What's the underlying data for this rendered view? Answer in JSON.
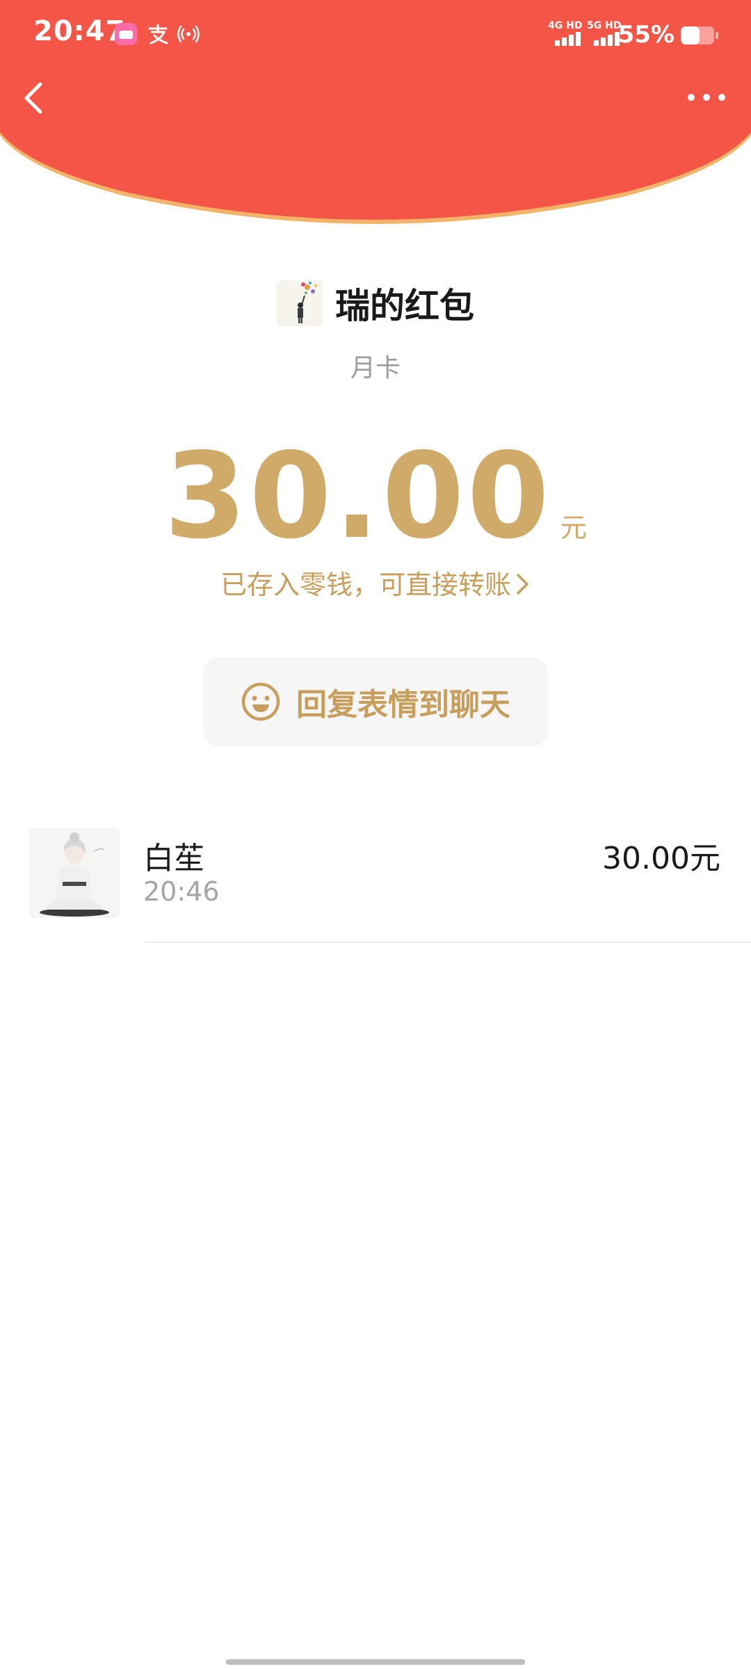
{
  "status_bar": {
    "time": "20:47",
    "network_1": "4G HD",
    "network_2": "5G HD",
    "battery": "55%"
  },
  "icons": {
    "back": "chevron-left-icon",
    "more": "more-dots-icon",
    "emoji": "smile-icon",
    "link_chevron": "chevron-right-icon"
  },
  "colors": {
    "header_red": "#f55547",
    "header_edge": "#f1b468",
    "gold": "#d0aa69",
    "gold_text": "#c79e5c"
  },
  "sender": {
    "title": "瑞的红包",
    "remark": "月卡"
  },
  "amount": {
    "value": "30.00",
    "unit": "元",
    "stored_text": "已存入零钱，可直接转账"
  },
  "reply_button": {
    "label": "回复表情到聊天"
  },
  "records": [
    {
      "name": "白苼",
      "time": "20:46",
      "amount": "30.00元"
    }
  ]
}
